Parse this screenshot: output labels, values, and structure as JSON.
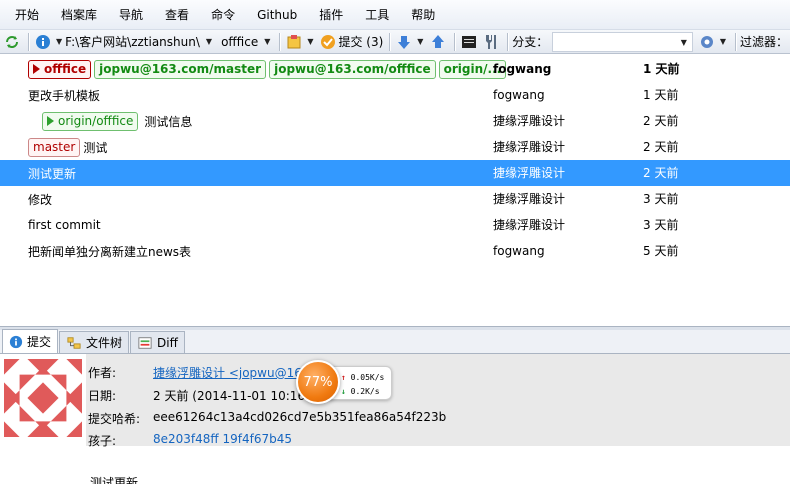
{
  "menubar": {
    "items": [
      "开始",
      "档案库",
      "导航",
      "查看",
      "命令",
      "Github",
      "插件",
      "工具",
      "帮助"
    ]
  },
  "toolbar": {
    "refresh_icon": "refresh-icon",
    "repo_path": "F:\\客户网站\\zztianshun\\",
    "current_branch": "offfice",
    "commit_label": "提交 (3)",
    "branch_label": "分支：",
    "filter_label": "过滤器："
  },
  "commits": [
    {
      "refs": [
        {
          "type": "head",
          "label": "offfice"
        },
        {
          "type": "local",
          "label": "jopwu@163.com/master"
        },
        {
          "type": "local",
          "label": "jopwu@163.com/offfice"
        },
        {
          "type": "local",
          "label": "origin/..."
        }
      ],
      "message": "",
      "author": "fogwang",
      "date": "1 天前"
    },
    {
      "refs": [],
      "message": "更改手机模板",
      "author": "fogwang",
      "date": "1 天前"
    },
    {
      "refs": [
        {
          "type": "remote",
          "label": "origin/offfice"
        }
      ],
      "message": "测试信息",
      "author": "捷缘浮雕设计",
      "date": "2 天前"
    },
    {
      "refs": [
        {
          "type": "master",
          "label": "master"
        }
      ],
      "message": "测试",
      "author": "捷缘浮雕设计",
      "date": "2 天前"
    },
    {
      "refs": [],
      "message": "测试更新",
      "author": "捷缘浮雕设计",
      "date": "2 天前"
    },
    {
      "refs": [],
      "message": "修改",
      "author": "捷缘浮雕设计",
      "date": "3 天前"
    },
    {
      "refs": [],
      "message": "first commit",
      "author": "捷缘浮雕设计",
      "date": "3 天前"
    },
    {
      "refs": [],
      "message": "把新闻单独分离新建立news表",
      "author": "fogwang",
      "date": "5 天前"
    }
  ],
  "selected_index": 4,
  "tabs": [
    "提交",
    "文件树",
    "Diff"
  ],
  "details": {
    "author_label": "作者:",
    "author_value": "捷缘浮雕设计 <jopwu@16",
    "date_label": "日期:",
    "date_value": "2 天前 (2014-11-01 10:16",
    "hash_label": "提交哈希:",
    "hash_value": "eee61264c13a4cd026cd7e5b351fea86a54f223b",
    "children_label": "孩子:",
    "children_value": "8e203f48ff 19f4f67b45",
    "message": "测试更新"
  },
  "speed": {
    "percent": "77%",
    "up": "0.05K/s",
    "down": "0.2K/s"
  }
}
